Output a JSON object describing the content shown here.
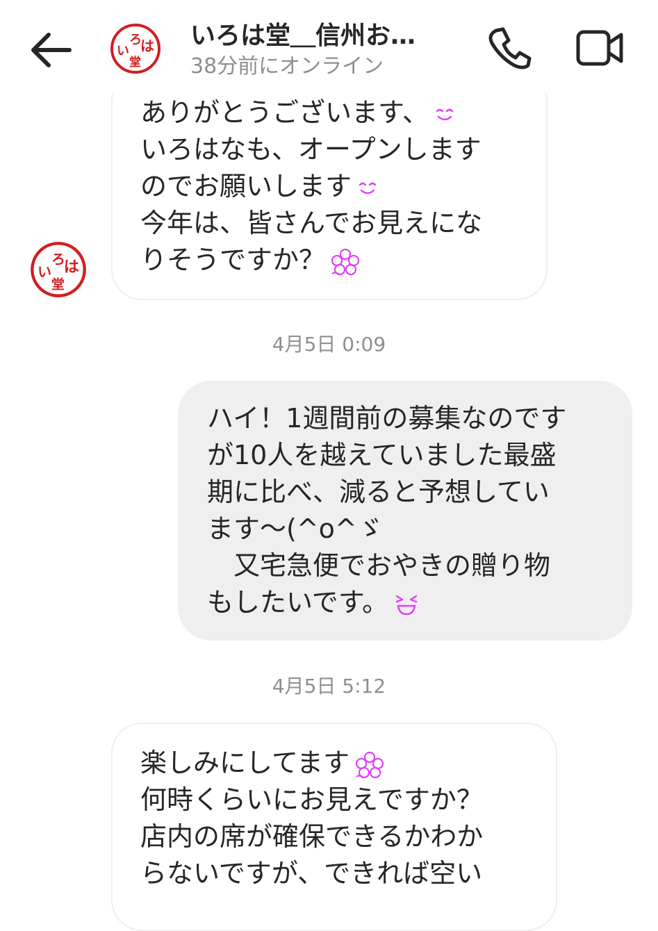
{
  "header": {
    "title": "いろは堂＿信州お…",
    "status": "38分前にオンライン",
    "back_icon": "arrow-left-icon",
    "call_icon": "phone-icon",
    "video_icon": "video-camera-icon",
    "avatar_text": [
      "ろ",
      "は",
      "い",
      "堂"
    ],
    "avatar_color": "#d21f1f"
  },
  "messages": [
    {
      "direction": "incoming",
      "lines": [
        "ありがとうございます、",
        "いろはなも、オープンします",
        "のでお願いします",
        "今年は、皆さんでお見えにな",
        "りそうですか？"
      ],
      "emoji": [
        "smile",
        "none",
        "smile",
        "none",
        "sakura"
      ]
    },
    {
      "timestamp": "4月5日 0:09"
    },
    {
      "direction": "outgoing",
      "lines": [
        "ハイ！1週間前の募集なのです",
        "が10人を越えていました最盛",
        "期に比べ、減ると予想してい",
        "ます〜(^o^ゞ",
        "　又宅急便でおやきの贈り物",
        "もしたいです。"
      ],
      "emoji": [
        "none",
        "none",
        "none",
        "none",
        "none",
        "grin"
      ]
    },
    {
      "timestamp": "4月5日 5:12"
    },
    {
      "direction": "incoming",
      "lines": [
        "楽しみにしてます",
        "何時くらいにお見えですか？",
        "店内の席が確保できるかわか",
        "らないですが、できれば空い"
      ],
      "emoji": [
        "sakura",
        "none",
        "none",
        "none"
      ]
    }
  ],
  "colors": {
    "incoming_bg": "#ffffff",
    "incoming_border": "#efefef",
    "outgoing_bg": "#efefef",
    "emoji": "#e040fb",
    "timestamp": "#8e8e8e"
  }
}
